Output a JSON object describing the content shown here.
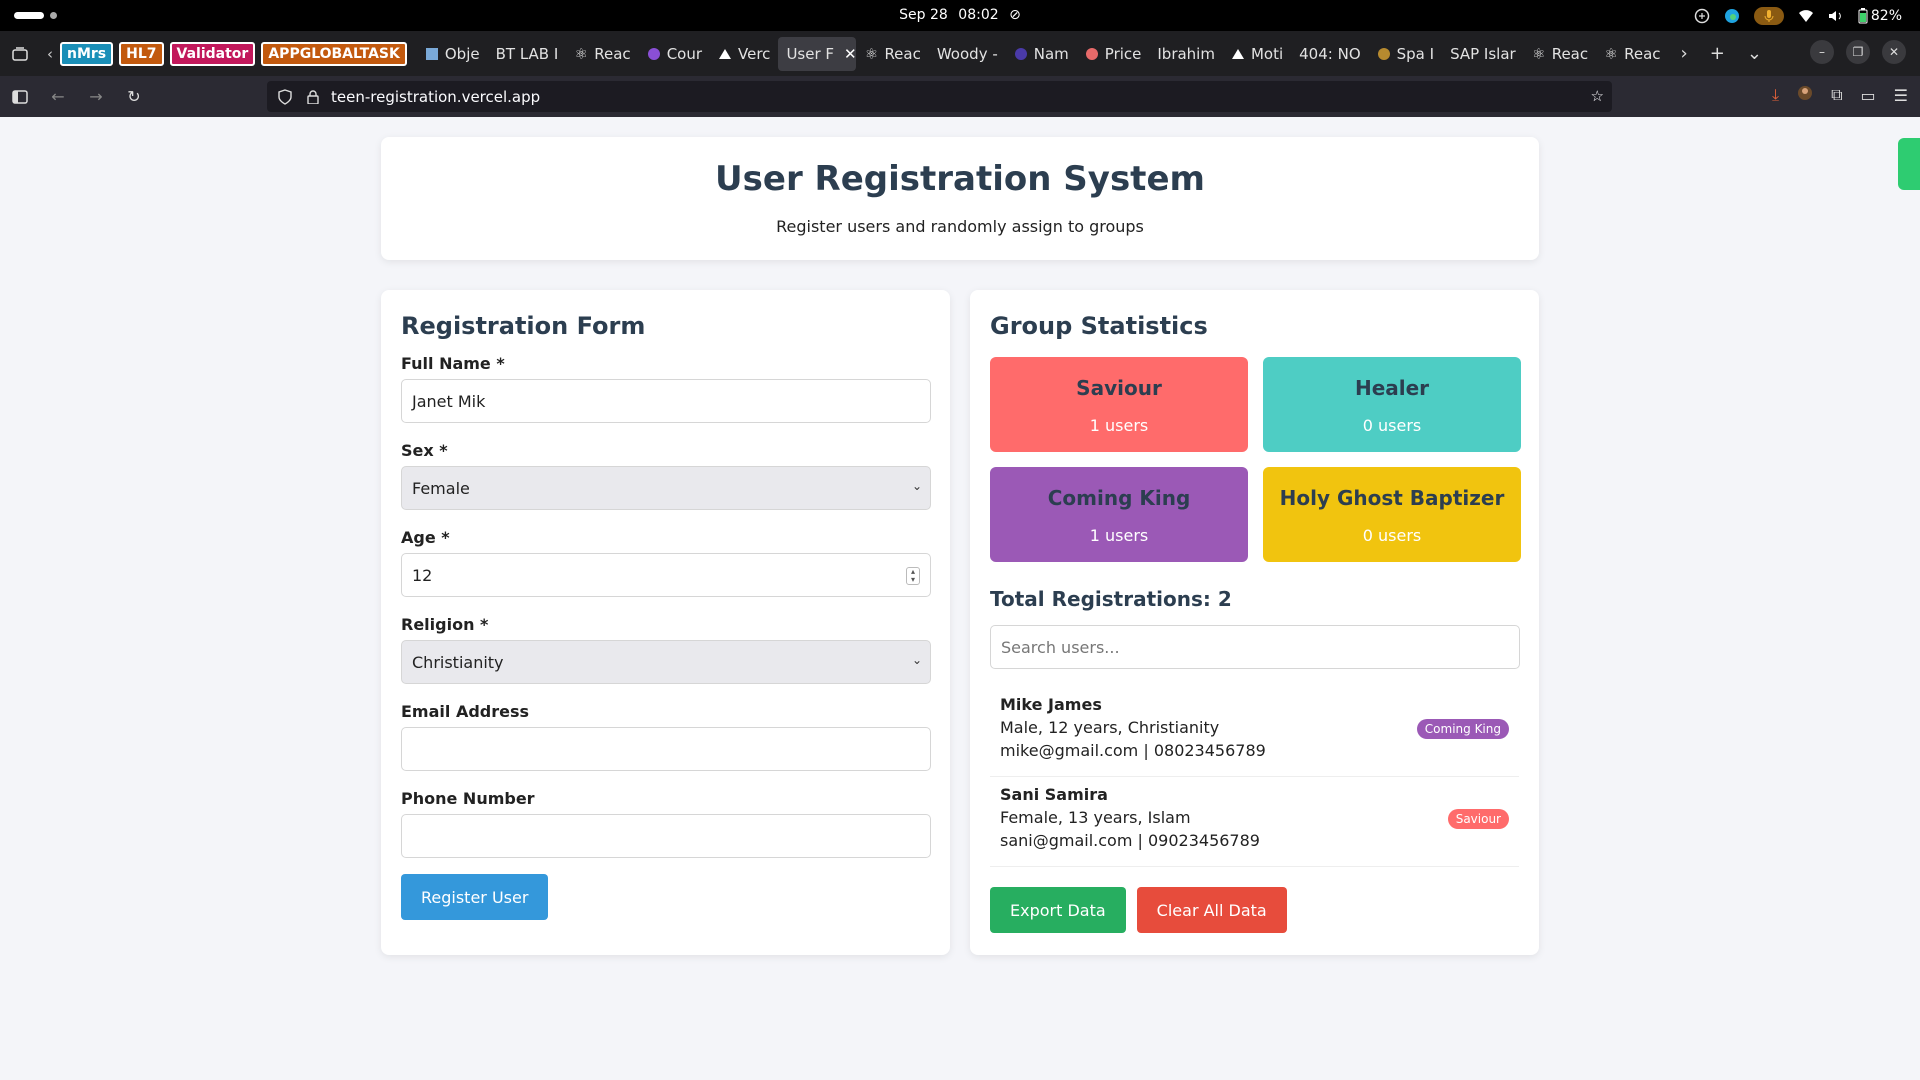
{
  "system": {
    "date": "Sep 28",
    "time": "08:02",
    "battery": "82%"
  },
  "tabs": {
    "pinned": [
      {
        "label": "nMrs",
        "color": "#1a8fb8"
      },
      {
        "label": "HL7",
        "color": "#c2590e"
      },
      {
        "label": "Validator",
        "color": "#c2185b"
      },
      {
        "label": "APPGLOBALTASK",
        "color": "#c2590e"
      }
    ],
    "items": [
      {
        "label": "Obje",
        "icon": "puzzle-icon"
      },
      {
        "label": "BT LAB I",
        "icon": ""
      },
      {
        "label": "Reac",
        "icon": "react-icon"
      },
      {
        "label": "Cour",
        "icon": "course-icon"
      },
      {
        "label": "Verc",
        "icon": "vercel-icon"
      },
      {
        "label": "User F",
        "icon": "",
        "active": true
      },
      {
        "label": "Reac",
        "icon": "react-icon"
      },
      {
        "label": "Woody -",
        "icon": ""
      },
      {
        "label": "Nam",
        "icon": "name-icon"
      },
      {
        "label": "Price",
        "icon": "price-icon"
      },
      {
        "label": "Ibrahim",
        "icon": ""
      },
      {
        "label": "Moti",
        "icon": "vercel-icon"
      },
      {
        "label": "404: NO",
        "icon": ""
      },
      {
        "label": "Spa I",
        "icon": "spa-icon"
      },
      {
        "label": "SAP Islar",
        "icon": ""
      },
      {
        "label": "Reac",
        "icon": "react-icon"
      },
      {
        "label": "Reac",
        "icon": "react-icon"
      }
    ]
  },
  "browser": {
    "url": "teen-registration.vercel.app"
  },
  "header": {
    "title": "User Registration System",
    "subtitle": "Register users and randomly assign to groups"
  },
  "form": {
    "title": "Registration Form",
    "full_name_label": "Full Name *",
    "full_name_value": "Janet Mik",
    "sex_label": "Sex *",
    "sex_value": "Female",
    "age_label": "Age *",
    "age_value": "12",
    "religion_label": "Religion *",
    "religion_value": "Christianity",
    "email_label": "Email Address",
    "email_value": "",
    "phone_label": "Phone Number",
    "phone_value": "",
    "submit_label": "Register User"
  },
  "stats": {
    "title": "Group Statistics",
    "groups": [
      {
        "name": "Saviour",
        "count": "1 users",
        "color": "#ff6b6b"
      },
      {
        "name": "Healer",
        "count": "0 users",
        "color": "#4ecdc4"
      },
      {
        "name": "Coming King",
        "count": "1 users",
        "color": "#9b59b6"
      },
      {
        "name": "Holy Ghost Baptizer",
        "count": "0 users",
        "color": "#f1c40f"
      }
    ],
    "total_label": "Total Registrations: 2",
    "search_placeholder": "Search users...",
    "users": [
      {
        "name": "Mike James",
        "details": "Male, 12 years, Christianity",
        "contact": "mike@gmail.com | 08023456789",
        "group": "Coming King",
        "group_color": "#9b59b6"
      },
      {
        "name": "Sani Samira",
        "details": "Female, 13 years, Islam",
        "contact": "sani@gmail.com | 09023456789",
        "group": "Saviour",
        "group_color": "#ff6b6b"
      }
    ],
    "export_label": "Export Data",
    "export_color": "#27ae60",
    "clear_label": "Clear All Data",
    "clear_color": "#e74c3c"
  }
}
